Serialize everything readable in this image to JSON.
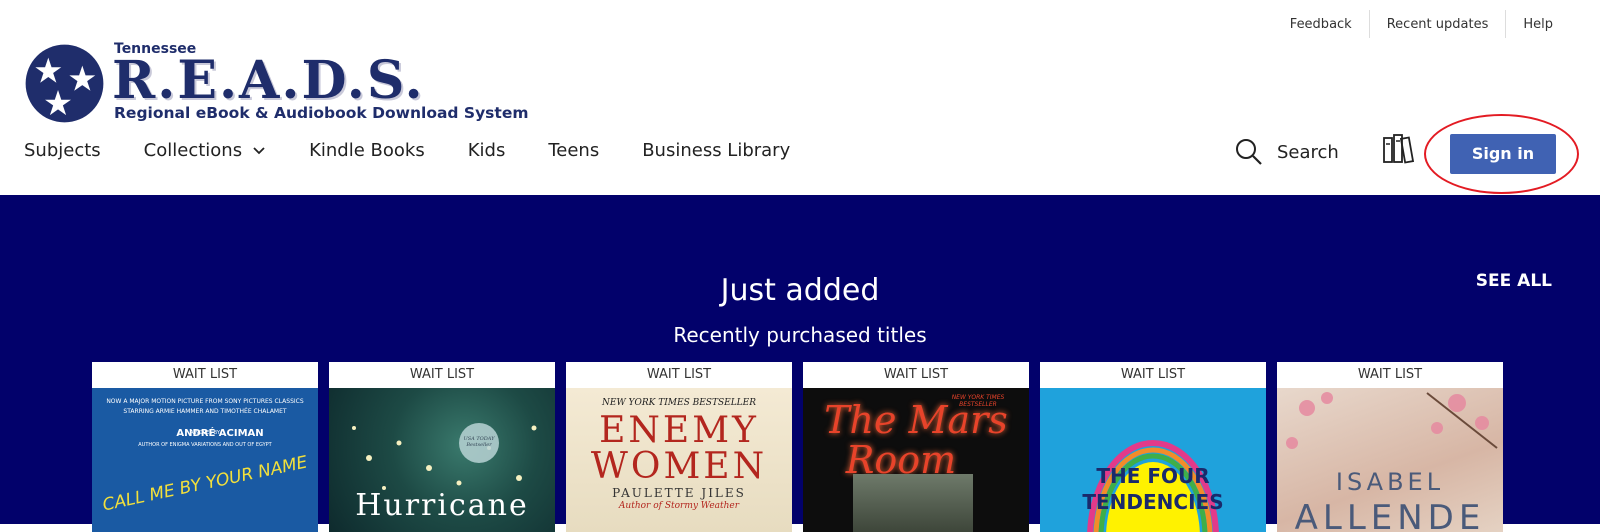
{
  "header": {
    "util_links": [
      "Feedback",
      "Recent updates",
      "Help"
    ],
    "logo": {
      "state": "Tennessee",
      "name": "R.E.A.D.S.",
      "tagline": "Regional eBook & Audiobook Download System"
    },
    "nav": {
      "subjects": "Subjects",
      "collections": "Collections",
      "kindle": "Kindle Books",
      "kids": "Kids",
      "teens": "Teens",
      "business": "Business Library"
    },
    "search_label": "Search",
    "signin_label": "Sign in"
  },
  "colors": {
    "brand_navy": "#1f2d6b",
    "band_bg": "#02016b",
    "signin_bg": "#4062b3",
    "highlight_circle": "#e31b23"
  },
  "feature": {
    "title": "Just added",
    "subtitle": "Recently purchased titles",
    "see_all": "SEE ALL"
  },
  "books": [
    {
      "status": "WAIT LIST",
      "cover": {
        "line1": "NOW A MAJOR MOTION PICTURE FROM SONY PICTURES CLASSICS",
        "line2": "STARRING ARMIE HAMMER AND TIMOTHÉE CHALAMET",
        "line3": "A NOVEL BY",
        "author": "ANDRÉ ACIMAN",
        "line4": "AUTHOR OF ENIGMA VARIATIONS AND OUT OF EGYPT",
        "title": "CALL ME BY YOUR NAME"
      }
    },
    {
      "status": "WAIT LIST",
      "cover": {
        "badge": "USA TODAY Bestseller",
        "title": "Hurricane"
      }
    },
    {
      "status": "WAIT LIST",
      "cover": {
        "line1": "NEW YORK TIMES BESTSELLER",
        "title1": "ENEMY",
        "title2": "WOMEN",
        "author": "PAULETTE JILES",
        "line2": "Author of Stormy Weather"
      }
    },
    {
      "status": "WAIT LIST",
      "cover": {
        "line1": "NEW YORK TIMES BESTSELLER",
        "title1": "The Mars",
        "title2": "Room"
      }
    },
    {
      "status": "WAIT LIST",
      "cover": {
        "title1": "THE FOUR",
        "title2": "TENDENCIES"
      }
    },
    {
      "status": "WAIT LIST",
      "cover": {
        "author1": "ISABEL",
        "author2": "ALLENDE"
      }
    }
  ]
}
